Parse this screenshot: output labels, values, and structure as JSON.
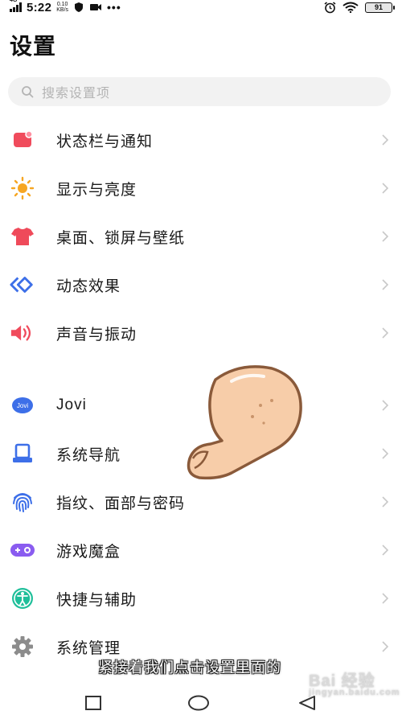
{
  "status_bar": {
    "network_type": "4G",
    "time": "5:22",
    "speed_value": "0.10",
    "speed_unit": "KB/s",
    "battery": "91"
  },
  "page": {
    "title": "设置",
    "search_placeholder": "搜索设置项"
  },
  "settings_items": [
    {
      "label": "状态栏与通知",
      "icon": "notification-icon",
      "color": "#f04b5c"
    },
    {
      "label": "显示与亮度",
      "icon": "sun-icon",
      "color": "#f6a623"
    },
    {
      "label": "桌面、锁屏与壁纸",
      "icon": "tshirt-icon",
      "color": "#ef4a5a"
    },
    {
      "label": "动态效果",
      "icon": "motion-icon",
      "color": "#3d6fe8"
    },
    {
      "label": "声音与振动",
      "icon": "speaker-icon",
      "color": "#f04b5c"
    },
    {
      "label": "Jovi",
      "icon": "jovi-icon",
      "color": "#3d6fe8"
    },
    {
      "label": "系统导航",
      "icon": "navigation-icon",
      "color": "#3d6fe8"
    },
    {
      "label": "指纹、面部与密码",
      "icon": "fingerprint-icon",
      "color": "#3d6fe8"
    },
    {
      "label": "游戏魔盒",
      "icon": "gamepad-icon",
      "color": "#8a5cf0"
    },
    {
      "label": "快捷与辅助",
      "icon": "accessibility-icon",
      "color": "#1fbf9a"
    },
    {
      "label": "系统管理",
      "icon": "gear-icon",
      "color": "#8c8c8c"
    }
  ],
  "overlay": {
    "subtitle": "紧接着我们点击设置里面的",
    "watermark": "Bai 经验",
    "watermark_sub": "jingyan.baidu.com"
  }
}
